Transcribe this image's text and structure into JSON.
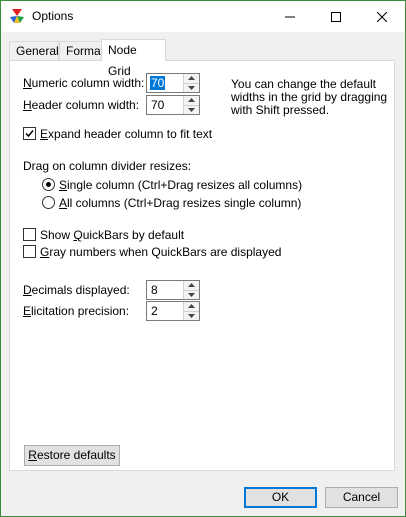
{
  "window": {
    "title": "Options",
    "icon": "app-color-icon",
    "controls": [
      "minimize-icon",
      "maximize-icon",
      "close-icon"
    ]
  },
  "tabs": [
    {
      "label": "General",
      "active": false
    },
    {
      "label": "Format",
      "active": false
    },
    {
      "label": "Node Grid",
      "active": true
    }
  ],
  "node_grid": {
    "numeric_width": {
      "label_accel": "N",
      "label_rest": "umeric column width:",
      "value": "70"
    },
    "header_width": {
      "label_accel": "H",
      "label_rest": "eader column width:",
      "value": "70"
    },
    "hint": [
      "You can change the default",
      "widths in the grid by dragging",
      "with Shift pressed."
    ],
    "expand_header": {
      "label_accel": "E",
      "label_rest": "xpand header column to fit text",
      "checked": true
    },
    "drag_heading": "Drag on column divider resizes:",
    "radio_single": {
      "label_accel": "S",
      "label_rest": "ingle column (Ctrl+Drag resizes all columns)",
      "selected": true
    },
    "radio_all": {
      "label_accel": "A",
      "label_rest": "ll columns (Ctrl+Drag resizes single column)",
      "selected": false
    },
    "show_quickbars": {
      "pre": "Show ",
      "accel": "Q",
      "post": "uickBars by default",
      "checked": false
    },
    "gray_numbers": {
      "accel": "G",
      "post": "ray numbers when QuickBars are displayed",
      "checked": false
    },
    "decimals": {
      "label_accel": "D",
      "label_rest": "ecimals displayed:",
      "value": "8"
    },
    "elicitation": {
      "label_accel": "E",
      "label_rest": "licitation precision:",
      "value": "2"
    },
    "restore": {
      "accel": "R",
      "rest": "estore defaults"
    }
  },
  "buttons": {
    "ok": "OK",
    "cancel": "Cancel"
  }
}
